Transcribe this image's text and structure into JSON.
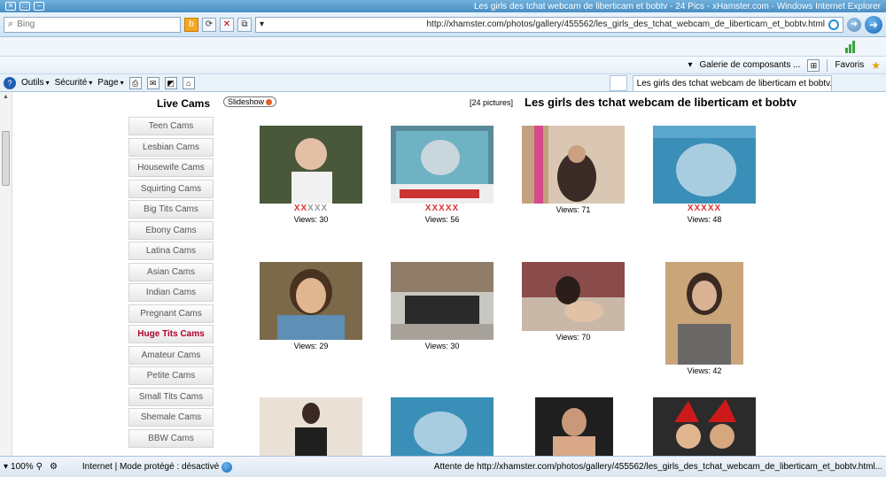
{
  "window": {
    "title": "Les girls des tchat webcam de liberticam et bobtv - 24 Pics - xHamster.com - Windows Internet Explorer"
  },
  "address": {
    "url": "http://xhamster.com/photos/gallery/455562/les_girls_des_tchat_webcam_de_liberticam_et_bobtv.html",
    "search_placeholder": "Bing"
  },
  "favorites": {
    "favorites_label": "Favoris",
    "gallery_label": "Galerie de composants ..."
  },
  "tab": {
    "label": "Les girls des tchat webcam de liberticam et bobtv..."
  },
  "commands": {
    "page": "Page",
    "security": "Sécurité",
    "tools": "Outils"
  },
  "sidebar": {
    "title": "Live Cams",
    "items": [
      {
        "label": "Teen Cams"
      },
      {
        "label": "Lesbian Cams"
      },
      {
        "label": "Housewife Cams"
      },
      {
        "label": "Squirting Cams"
      },
      {
        "label": "Big Tits Cams"
      },
      {
        "label": "Ebony Cams"
      },
      {
        "label": "Latina Cams"
      },
      {
        "label": "Asian Cams"
      },
      {
        "label": "Indian Cams"
      },
      {
        "label": "Pregnant Cams"
      },
      {
        "label": "Huge Tits Cams"
      },
      {
        "label": "Amateur Cams"
      },
      {
        "label": "Petite Cams"
      },
      {
        "label": "Small Tits Cams"
      },
      {
        "label": "Shemale Cams"
      },
      {
        "label": "BBW Cams"
      }
    ]
  },
  "gallery": {
    "title": "Les girls des tchat webcam de liberticam et bobtv",
    "count": "[24 pictures]",
    "slideshow": "Slideshow",
    "thumbs": [
      {
        "views": "Views: 48",
        "stars": "XXXXX",
        "lit": 5
      },
      {
        "views": "Views: 71",
        "stars": "",
        "lit": 0
      },
      {
        "views": "Views: 56",
        "stars": "XXXXX",
        "lit": 5
      },
      {
        "views": "Views: 30",
        "stars": "XXXXX",
        "lit": 2
      },
      {
        "views": "Views: 42",
        "stars": "",
        "lit": 0
      },
      {
        "views": "Views: 70",
        "stars": "",
        "lit": 0
      },
      {
        "views": "Views: 30",
        "stars": "",
        "lit": 0
      },
      {
        "views": "Views: 29",
        "stars": "",
        "lit": 0
      }
    ]
  },
  "status": {
    "main": "Attente de http://xhamster.com/photos/gallery/455562/les_girls_des_tchat_webcam_de_liberticam_et_bobtv.html...",
    "zone": "Internet | Mode protégé : désactivé",
    "zoom": "100%"
  }
}
